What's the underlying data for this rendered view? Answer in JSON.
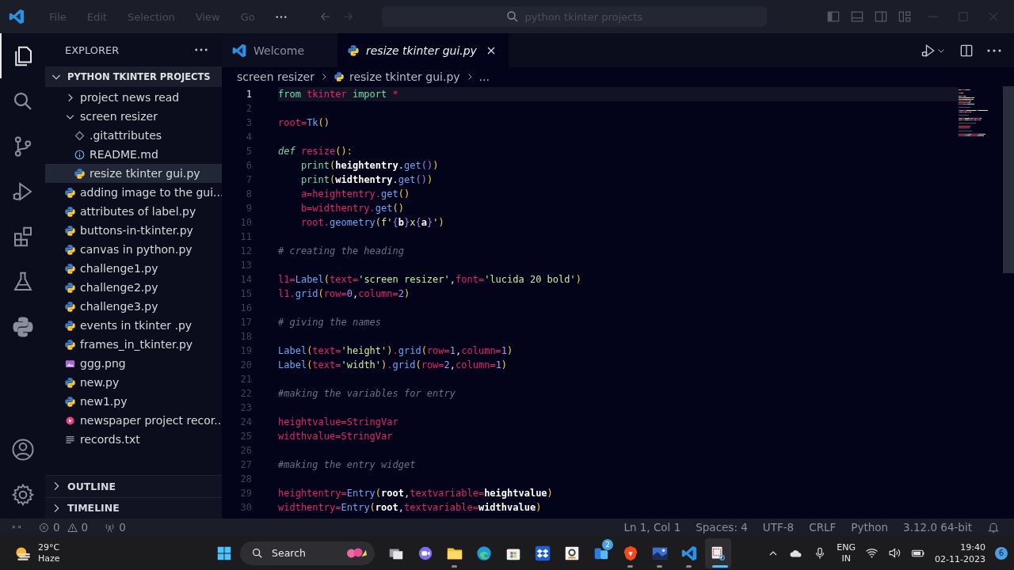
{
  "title_bar": {
    "menus": [
      "File",
      "Edit",
      "Selection",
      "View",
      "Go"
    ],
    "search": "python tkinter projects"
  },
  "activity_bar": {
    "top": [
      {
        "kind": "files",
        "selected": true
      },
      {
        "kind": "search",
        "selected": false
      },
      {
        "kind": "source-control",
        "selected": false
      },
      {
        "kind": "run-debug",
        "selected": false
      },
      {
        "kind": "extensions",
        "selected": false
      },
      {
        "kind": "flask",
        "selected": false
      },
      {
        "kind": "python",
        "selected": false
      }
    ],
    "bottom": [
      {
        "kind": "account",
        "selected": false
      },
      {
        "kind": "settings",
        "selected": false
      }
    ]
  },
  "explorer": {
    "title": "EXPLORER",
    "root": {
      "label": "PYTHON TKINTER PROJECTS",
      "expanded": true
    },
    "items": [
      {
        "label": "project news read",
        "kind": "folder",
        "expanded": false,
        "selected": false
      },
      {
        "label": "screen resizer",
        "kind": "folder",
        "expanded": true,
        "selected": false,
        "children": [
          {
            "label": ".gitattributes",
            "kind": "git",
            "selected": false
          },
          {
            "label": "README.md",
            "kind": "info",
            "selected": false
          },
          {
            "label": "resize tkinter gui.py",
            "kind": "py",
            "selected": true
          }
        ]
      },
      {
        "label": "adding image to the gui...",
        "kind": "py",
        "selected": false
      },
      {
        "label": "attributes of label.py",
        "kind": "py",
        "selected": false
      },
      {
        "label": "buttons-in-tkinter.py",
        "kind": "py",
        "selected": false
      },
      {
        "label": "canvas in python.py",
        "kind": "py",
        "selected": false
      },
      {
        "label": "challenge1.py",
        "kind": "py",
        "selected": false
      },
      {
        "label": "challenge2.py",
        "kind": "py",
        "selected": false
      },
      {
        "label": "challenge3.py",
        "kind": "py",
        "selected": false
      },
      {
        "label": "events in tkinter .py",
        "kind": "py",
        "selected": false
      },
      {
        "label": "frames_in_tkinter.py",
        "kind": "py",
        "selected": false
      },
      {
        "label": "ggg.png",
        "kind": "image",
        "selected": false
      },
      {
        "label": "new.py",
        "kind": "py",
        "selected": false
      },
      {
        "label": "new1.py",
        "kind": "py",
        "selected": false
      },
      {
        "label": "newspaper project recor...",
        "kind": "media",
        "selected": false
      },
      {
        "label": "records.txt",
        "kind": "text",
        "selected": false
      }
    ],
    "panels": [
      {
        "label": "OUTLINE",
        "expanded": false
      },
      {
        "label": "TIMELINE",
        "expanded": false
      }
    ]
  },
  "tabs": [
    {
      "label": "Welcome",
      "kind": "vscode",
      "selected": false
    },
    {
      "label": "resize tkinter gui.py",
      "kind": "py",
      "selected": true
    }
  ],
  "breadcrumbs": [
    {
      "label": "screen resizer",
      "kind": "folder"
    },
    {
      "label": "resize tkinter gui.py",
      "kind": "py"
    },
    {
      "label": "...",
      "kind": "more"
    }
  ],
  "code": [
    {
      "n": "1",
      "active": true,
      "tokens": [
        {
          "kind": "kw",
          "text": "from "
        },
        {
          "kind": "var",
          "text": "tkinter "
        },
        {
          "kind": "kw",
          "text": "import "
        },
        {
          "kind": "var",
          "text": "*"
        }
      ]
    },
    {
      "n": "2",
      "active": false
    },
    {
      "n": "3",
      "active": false,
      "tokens": [
        {
          "kind": "var",
          "text": "root="
        },
        {
          "kind": "cls",
          "text": "Tk"
        },
        {
          "kind": "pu",
          "text": "()"
        }
      ]
    },
    {
      "n": "4",
      "active": false
    },
    {
      "n": "5",
      "active": false,
      "tokens": [
        {
          "kind": "kwi",
          "text": "def "
        },
        {
          "kind": "var",
          "text": "resize"
        },
        {
          "kind": "pu",
          "text": "():"
        }
      ]
    },
    {
      "n": "6",
      "active": false,
      "tokens": [
        {
          "kind": "kw",
          "text": "    print"
        },
        {
          "kind": "pu",
          "text": "("
        },
        {
          "kind": "bo",
          "text": "heightentry"
        },
        {
          "kind": "pl",
          "text": "."
        },
        {
          "kind": "cls",
          "text": "get"
        },
        {
          "kind": "pu2",
          "text": "()"
        },
        {
          "kind": "pu",
          "text": ")"
        }
      ]
    },
    {
      "n": "7",
      "active": false,
      "tokens": [
        {
          "kind": "kw",
          "text": "    print"
        },
        {
          "kind": "pu",
          "text": "("
        },
        {
          "kind": "bo",
          "text": "widthentry"
        },
        {
          "kind": "pl",
          "text": "."
        },
        {
          "kind": "cls",
          "text": "get"
        },
        {
          "kind": "pu2",
          "text": "()"
        },
        {
          "kind": "pu",
          "text": ")"
        }
      ]
    },
    {
      "n": "8",
      "active": false,
      "tokens": [
        {
          "kind": "var",
          "text": "    a=heightentry."
        },
        {
          "kind": "cls",
          "text": "get"
        },
        {
          "kind": "pu",
          "text": "()"
        }
      ]
    },
    {
      "n": "9",
      "active": false,
      "tokens": [
        {
          "kind": "var",
          "text": "    b=widthentry."
        },
        {
          "kind": "cls",
          "text": "get"
        },
        {
          "kind": "pu",
          "text": "()"
        }
      ]
    },
    {
      "n": "10",
      "active": false,
      "tokens": [
        {
          "kind": "var",
          "text": "    root."
        },
        {
          "kind": "cls",
          "text": "geometry"
        },
        {
          "kind": "pu",
          "text": "("
        },
        {
          "kind": "str",
          "text": "f'"
        },
        {
          "kind": "pu2",
          "text": "{"
        },
        {
          "kind": "bo",
          "text": "b"
        },
        {
          "kind": "pu2",
          "text": "}"
        },
        {
          "kind": "str",
          "text": "x"
        },
        {
          "kind": "pu2",
          "text": "{"
        },
        {
          "kind": "bo",
          "text": "a"
        },
        {
          "kind": "pu2",
          "text": "}"
        },
        {
          "kind": "str",
          "text": "'"
        },
        {
          "kind": "pu",
          "text": ")"
        }
      ]
    },
    {
      "n": "11",
      "active": false
    },
    {
      "n": "12",
      "active": false,
      "tokens": [
        {
          "kind": "com",
          "text": "# creating the heading"
        }
      ]
    },
    {
      "n": "13",
      "active": false
    },
    {
      "n": "14",
      "active": false,
      "tokens": [
        {
          "kind": "var",
          "text": "l1="
        },
        {
          "kind": "cls",
          "text": "Label"
        },
        {
          "kind": "pu",
          "text": "("
        },
        {
          "kind": "var",
          "text": "text="
        },
        {
          "kind": "str",
          "text": "'screen resizer'"
        },
        {
          "kind": "pl",
          "text": ","
        },
        {
          "kind": "var",
          "text": "font="
        },
        {
          "kind": "str",
          "text": "'lucida 20 bold'"
        },
        {
          "kind": "pu",
          "text": ")"
        }
      ]
    },
    {
      "n": "15",
      "active": false,
      "tokens": [
        {
          "kind": "var",
          "text": "l1."
        },
        {
          "kind": "cls",
          "text": "grid"
        },
        {
          "kind": "pu",
          "text": "("
        },
        {
          "kind": "var",
          "text": "row="
        },
        {
          "kind": "num",
          "text": "0"
        },
        {
          "kind": "pl",
          "text": ","
        },
        {
          "kind": "var",
          "text": "column="
        },
        {
          "kind": "num",
          "text": "2"
        },
        {
          "kind": "pu",
          "text": ")"
        }
      ]
    },
    {
      "n": "16",
      "active": false
    },
    {
      "n": "17",
      "active": false,
      "tokens": [
        {
          "kind": "com",
          "text": "# giving the names"
        }
      ]
    },
    {
      "n": "18",
      "active": false
    },
    {
      "n": "19",
      "active": false,
      "tokens": [
        {
          "kind": "cls",
          "text": "Label"
        },
        {
          "kind": "pu",
          "text": "("
        },
        {
          "kind": "var",
          "text": "text="
        },
        {
          "kind": "str",
          "text": "'height'"
        },
        {
          "kind": "pu",
          "text": ")"
        },
        {
          "kind": "var",
          "text": "."
        },
        {
          "kind": "cls",
          "text": "grid"
        },
        {
          "kind": "pu",
          "text": "("
        },
        {
          "kind": "var",
          "text": "row="
        },
        {
          "kind": "num",
          "text": "1"
        },
        {
          "kind": "pl",
          "text": ","
        },
        {
          "kind": "var",
          "text": "column="
        },
        {
          "kind": "num",
          "text": "1"
        },
        {
          "kind": "pu",
          "text": ")"
        }
      ]
    },
    {
      "n": "20",
      "active": false,
      "tokens": [
        {
          "kind": "cls",
          "text": "Label"
        },
        {
          "kind": "pu",
          "text": "("
        },
        {
          "kind": "var",
          "text": "text="
        },
        {
          "kind": "str",
          "text": "'width'"
        },
        {
          "kind": "pu",
          "text": ")"
        },
        {
          "kind": "var",
          "text": "."
        },
        {
          "kind": "cls",
          "text": "grid"
        },
        {
          "kind": "pu",
          "text": "("
        },
        {
          "kind": "var",
          "text": "row="
        },
        {
          "kind": "num",
          "text": "2"
        },
        {
          "kind": "pl",
          "text": ","
        },
        {
          "kind": "var",
          "text": "column="
        },
        {
          "kind": "num",
          "text": "1"
        },
        {
          "kind": "pu",
          "text": ")"
        }
      ]
    },
    {
      "n": "21",
      "active": false
    },
    {
      "n": "22",
      "active": false,
      "tokens": [
        {
          "kind": "com",
          "text": "#making the variables for entry"
        }
      ]
    },
    {
      "n": "23",
      "active": false
    },
    {
      "n": "24",
      "active": false,
      "tokens": [
        {
          "kind": "var",
          "text": "heightvalue=StringVar"
        }
      ]
    },
    {
      "n": "25",
      "active": false,
      "tokens": [
        {
          "kind": "var",
          "text": "widthvalue=StringVar"
        }
      ]
    },
    {
      "n": "26",
      "active": false
    },
    {
      "n": "27",
      "active": false,
      "tokens": [
        {
          "kind": "com",
          "text": "#making the entry widget"
        }
      ]
    },
    {
      "n": "28",
      "active": false
    },
    {
      "n": "29",
      "active": false,
      "tokens": [
        {
          "kind": "var",
          "text": "heightentry="
        },
        {
          "kind": "cls",
          "text": "Entry"
        },
        {
          "kind": "pu",
          "text": "("
        },
        {
          "kind": "bo",
          "text": "root"
        },
        {
          "kind": "pl",
          "text": ","
        },
        {
          "kind": "var",
          "text": "textvariable="
        },
        {
          "kind": "bo",
          "text": "heightvalue"
        },
        {
          "kind": "pu",
          "text": ")"
        }
      ]
    },
    {
      "n": "30",
      "active": false,
      "tokens": [
        {
          "kind": "var",
          "text": "widthentry="
        },
        {
          "kind": "cls",
          "text": "Entry"
        },
        {
          "kind": "pu",
          "text": "("
        },
        {
          "kind": "bo",
          "text": "root"
        },
        {
          "kind": "pl",
          "text": ","
        },
        {
          "kind": "var",
          "text": "textvariable="
        },
        {
          "kind": "bo",
          "text": "widthvalue"
        },
        {
          "kind": "pu",
          "text": ")"
        }
      ]
    }
  ],
  "status_bar": {
    "left": [
      {
        "kind": "error",
        "text": "0"
      },
      {
        "kind": "warning",
        "text": "0"
      },
      {
        "kind": "ports",
        "text": "0"
      }
    ],
    "right": [
      "Ln 1, Col 1",
      "Spaces: 4",
      "UTF-8",
      "CRLF",
      "Python",
      "3.12.0 64-bit"
    ]
  },
  "taskbar": {
    "weather": {
      "temp": "29°C",
      "condition": "Haze"
    },
    "search": "Search",
    "apps": [
      {
        "kind": "task-view",
        "open": false,
        "active": false
      },
      {
        "kind": "meet",
        "open": false,
        "active": false
      },
      {
        "kind": "folder",
        "open": true,
        "active": false
      },
      {
        "kind": "edge",
        "open": false,
        "active": false
      },
      {
        "kind": "store",
        "open": false,
        "active": false
      },
      {
        "kind": "dropbox",
        "open": false,
        "active": false
      },
      {
        "kind": "amazon",
        "open": false,
        "active": false
      },
      {
        "kind": "widgets",
        "open": false,
        "active": false,
        "badge": "2"
      },
      {
        "kind": "brave",
        "open": true,
        "active": false
      },
      {
        "kind": "photo",
        "open": true,
        "active": false
      },
      {
        "kind": "vscode",
        "open": true,
        "active": false
      },
      {
        "kind": "snip",
        "open": true,
        "active": true
      }
    ],
    "language": [
      "ENG",
      "IN"
    ],
    "time": "19:40",
    "date": "02-11-2023",
    "notifications": "6"
  }
}
